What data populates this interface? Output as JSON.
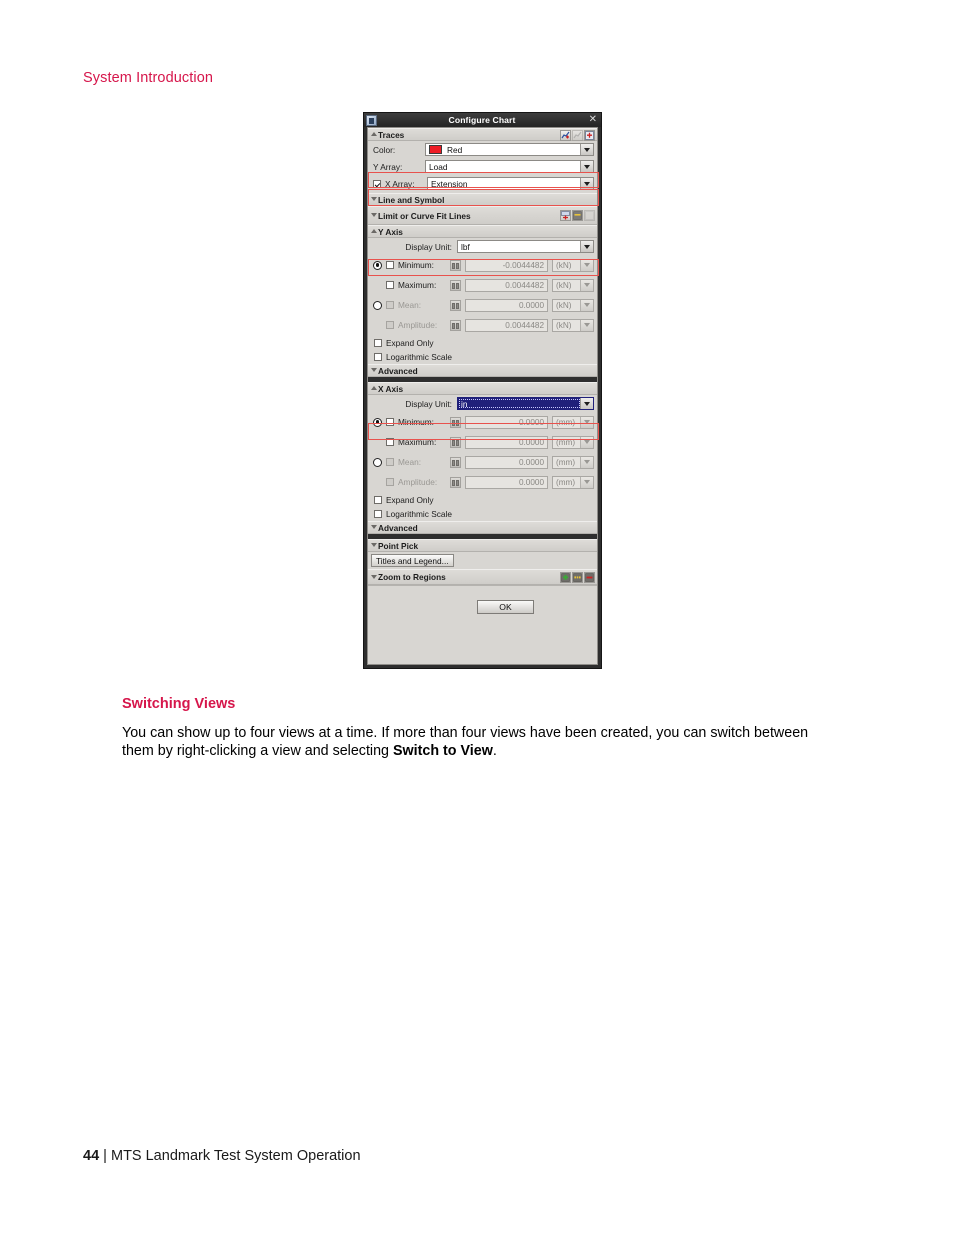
{
  "page": {
    "running_head": "System Introduction",
    "footer_page_number": "44",
    "footer_separator": "|",
    "footer_title": "MTS Landmark Test System Operation",
    "section_heading": "Switching Views",
    "body_text_part1": "You can show up to four views at a time. If more than four views have been created, you can switch between them by right-clicking a view and selecting ",
    "body_text_bold": "Switch to View",
    "body_text_part2": "."
  },
  "colors": {
    "accent_red": "#d6164b",
    "highlight_box": "#e8524d",
    "trace_color_swatch": "#ee1c25",
    "selection_blue": "#20207a",
    "titlebar_dark": "#2e2e2e"
  },
  "dialog": {
    "title": "Configure Chart",
    "app_icon": "window-app-icon",
    "close_icon": "close-icon",
    "ok_label": "OK",
    "sections": {
      "traces": {
        "label": "Traces",
        "expanded": true,
        "tool_icons": [
          "add-trace-icon",
          "edit-trace-icon",
          "remove-trace-icon"
        ]
      },
      "line_and_symbol": {
        "label": "Line and Symbol",
        "expanded": false
      },
      "limit_or_curve_fit_lines": {
        "label": "Limit or Curve Fit Lines",
        "expanded": false,
        "tool_icons": [
          "add-limit-line-icon",
          "edit-limit-line-icon",
          "remove-limit-line-icon"
        ]
      },
      "y_axis": {
        "label": "Y Axis",
        "expanded": true
      },
      "x_axis": {
        "label": "X Axis",
        "expanded": true
      },
      "advanced_y": {
        "label": "Advanced",
        "expanded": false
      },
      "advanced_x": {
        "label": "Advanced",
        "expanded": false
      },
      "point_pick": {
        "label": "Point Pick",
        "expanded": false
      },
      "zoom_to_regions": {
        "label": "Zoom to Regions",
        "expanded": false,
        "tool_icons": [
          "add-region-icon",
          "edit-region-icon",
          "remove-region-icon"
        ]
      }
    },
    "traces": {
      "color_label": "Color:",
      "color_value": "Red",
      "y_array_label": "Y Array:",
      "y_array_value": "Load",
      "x_array_label": "X Array:",
      "x_array_value": "Extension",
      "x_array_checked": true
    },
    "y_axis": {
      "display_unit_label": "Display Unit:",
      "display_unit_value": "lbf",
      "minmax_selected": true,
      "meanamp_selected": false,
      "rows": [
        {
          "label": "Minimum:",
          "checked": false,
          "disabled": false,
          "value": "-0.0044482",
          "unit": "(kN)"
        },
        {
          "label": "Maximum:",
          "checked": false,
          "disabled": false,
          "value": "0.0044482",
          "unit": "(kN)"
        },
        {
          "label": "Mean:",
          "checked": false,
          "disabled": true,
          "value": "0.0000",
          "unit": "(kN)"
        },
        {
          "label": "Amplitude:",
          "checked": false,
          "disabled": true,
          "value": "0.0044482",
          "unit": "(kN)"
        }
      ],
      "expand_only_label": "Expand Only",
      "expand_only_checked": false,
      "log_scale_label": "Logarithmic Scale",
      "log_scale_checked": false
    },
    "x_axis": {
      "display_unit_label": "Display Unit:",
      "display_unit_value": "in",
      "display_unit_selected": true,
      "minmax_selected": true,
      "meanamp_selected": false,
      "rows": [
        {
          "label": "Minimum:",
          "checked": false,
          "disabled": false,
          "value": "0.0000",
          "unit": "(mm)"
        },
        {
          "label": "Maximum:",
          "checked": false,
          "disabled": false,
          "value": "0.0000",
          "unit": "(mm)"
        },
        {
          "label": "Mean:",
          "checked": false,
          "disabled": true,
          "value": "0.0000",
          "unit": "(mm)"
        },
        {
          "label": "Amplitude:",
          "checked": false,
          "disabled": true,
          "value": "0.0000",
          "unit": "(mm)"
        }
      ],
      "expand_only_label": "Expand Only",
      "expand_only_checked": false,
      "log_scale_label": "Logarithmic Scale",
      "log_scale_checked": false
    },
    "titles_and_legend_label": "Titles and Legend..."
  }
}
